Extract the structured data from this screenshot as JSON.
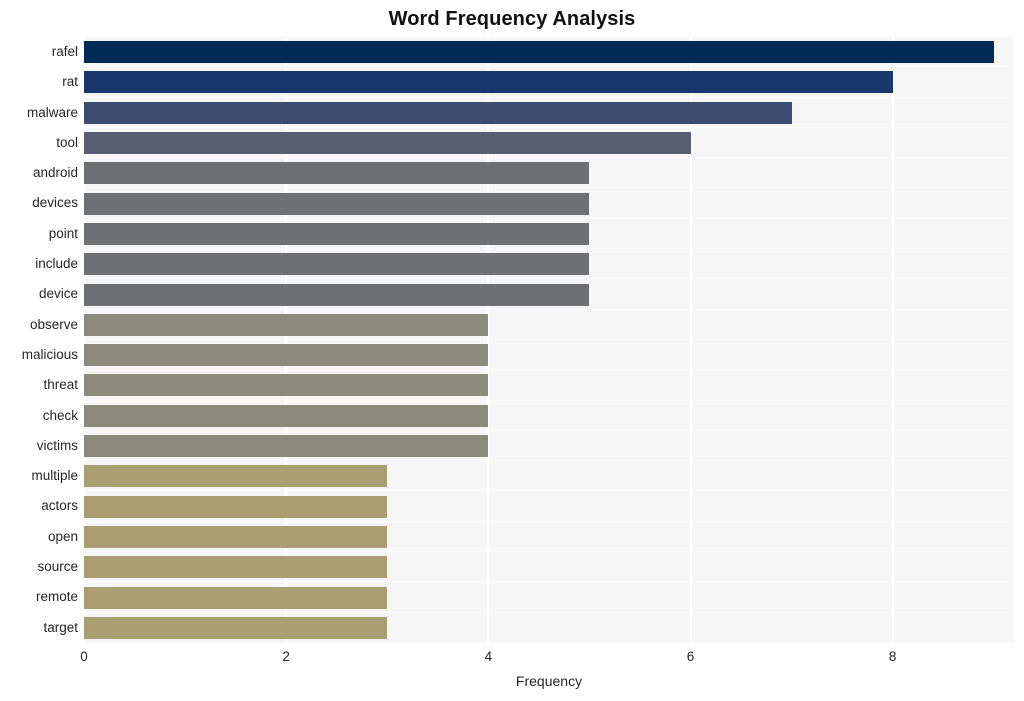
{
  "chart_data": {
    "type": "bar",
    "orientation": "horizontal",
    "title": "Word Frequency Analysis",
    "xlabel": "Frequency",
    "ylabel": "",
    "xlim": [
      0,
      9.2
    ],
    "xticks": [
      0,
      2,
      4,
      6,
      8
    ],
    "xtick_labels": [
      "0",
      "2",
      "4",
      "6",
      "8"
    ],
    "grid": true,
    "grid_axis": "x",
    "legend": null,
    "categories": [
      "rafel",
      "rat",
      "malware",
      "tool",
      "android",
      "devices",
      "point",
      "include",
      "device",
      "observe",
      "malicious",
      "threat",
      "check",
      "victims",
      "multiple",
      "actors",
      "open",
      "source",
      "remote",
      "target"
    ],
    "values": [
      9,
      8,
      7,
      6,
      5,
      5,
      5,
      5,
      5,
      4,
      4,
      4,
      4,
      4,
      3,
      3,
      3,
      3,
      3,
      3
    ],
    "bar_colors": [
      "#012a55",
      "#17376d",
      "#3f4a70",
      "#585d73",
      "#6e7074",
      "#6e7074",
      "#6e7074",
      "#6e7074",
      "#6e7074",
      "#8b8979",
      "#8b8979",
      "#8b8979",
      "#8b8979",
      "#8b8979",
      "#a89e72",
      "#a89e72",
      "#a89e72",
      "#a89e72",
      "#a89e72",
      "#a89e72"
    ],
    "plot_background": "#f6f6f7",
    "figure_background": "#ffffff",
    "gridline_color": "#ffffff"
  }
}
